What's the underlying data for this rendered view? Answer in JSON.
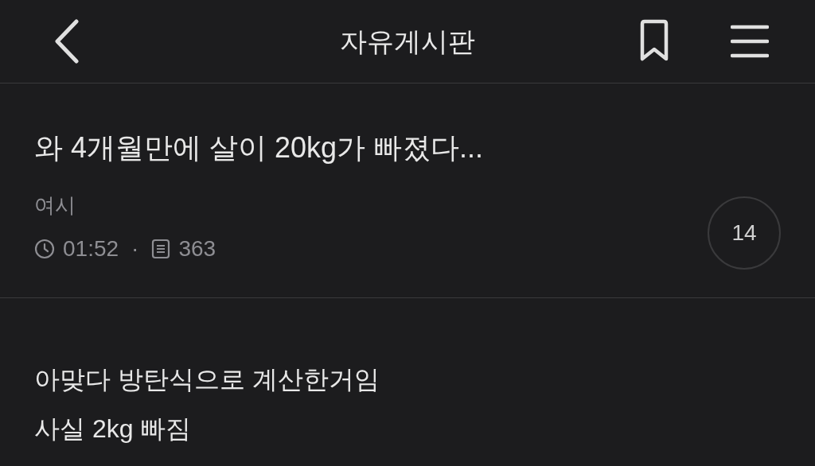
{
  "header": {
    "title": "자유게시판"
  },
  "post": {
    "title": "와 4개월만에 살이 20kg가 빠졌다...",
    "author": "여시",
    "time": "01:52",
    "separator": "·",
    "views": "363",
    "comment_count": "14"
  },
  "body": [
    "아맞다 방탄식으로 계산한거임",
    "사실 2kg 빠짐"
  ]
}
